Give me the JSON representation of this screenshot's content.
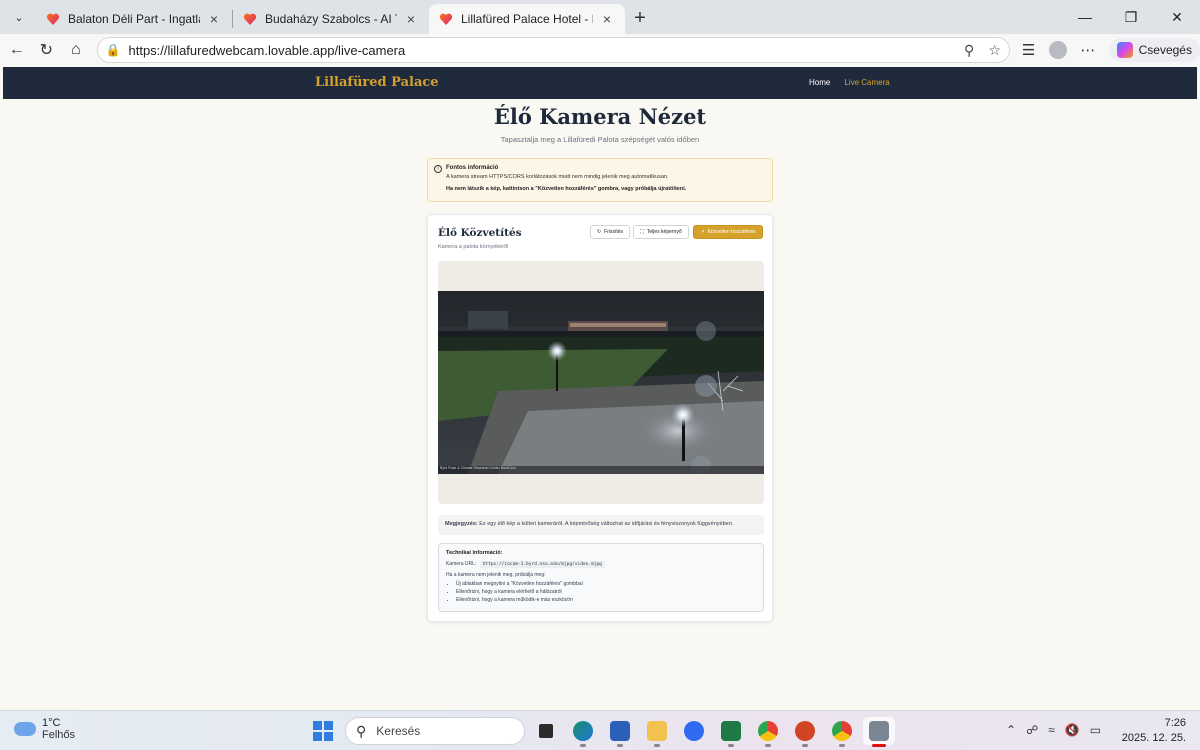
{
  "browser": {
    "tabs": [
      {
        "title": "Balaton Déli Part - Ingatlanfejlesztés",
        "active": false
      },
      {
        "title": "Budaházy Szabolcs - AI Tanácsadó",
        "active": false
      },
      {
        "title": "Lillafüred Palace Hotel - Luxury Hotel",
        "active": true
      }
    ],
    "url": "https://lillafuredwebcam.lovable.app/live-camera",
    "copilot_label": "Csevegés",
    "icons": [
      "back-icon",
      "refresh-icon",
      "home-icon",
      "zoom-icon",
      "favorite-star-icon",
      "favorites-icon",
      "profile-icon",
      "more-icon"
    ]
  },
  "site": {
    "logo": "Lillafüred Palace",
    "nav": {
      "home": "Home",
      "live": "Live Camera"
    },
    "accent_color": "#d4a22c",
    "header_color": "#1f2a3c"
  },
  "page": {
    "title": "Élő Kamera Nézet",
    "subtitle": "Tapasztalja meg a Lillafüredi Palota szépségét valós időben"
  },
  "info": {
    "heading": "Fontos információ",
    "line1": "A kamera stream HTTPS/CORS korlátozások miatt nem mindig jelenik meg automatikusan.",
    "line2": "Ha nem látszik a kép, kattintson a \"Közvetlen hozzáférés\" gombra, vagy próbálja újratölteni."
  },
  "camera": {
    "title": "Élő Közvetítés",
    "subtitle": "Kamera a palota környékéről",
    "buttons": {
      "refresh": "Frissítés",
      "fullscreen": "Teljes képernyő",
      "direct": "Közvetlen hozzáférés"
    },
    "caption": "Byrd Polar & Climate Research Center BurdCam"
  },
  "note": {
    "label": "Megjegyzés:",
    "text": "Ez egy élő kép a külteri kameráról. A képminőség változhat az időjárási és fényviszonyok függvényében."
  },
  "tech": {
    "heading": "Technikai információ:",
    "url_label": "Kamera URL:",
    "url_value": "https://iocam-1.byrd.osu.edu/mjpg/video.mjpg",
    "intro": "Ha a kamera nem jelenik meg, próbálja meg:",
    "items": [
      "Új ablakban megnyitni a \"Közvetlen hozzáférés\" gombbal",
      "Ellenőrizni, hogy a kamera elérhető a hálózatról",
      "Ellenőrizni, hogy a kamera működik-e más eszközön"
    ]
  },
  "taskbar": {
    "temp": "1°C",
    "weather": "Felhős",
    "search_placeholder": "Keresés",
    "time": "7:26",
    "date": "2025. 12. 25."
  }
}
